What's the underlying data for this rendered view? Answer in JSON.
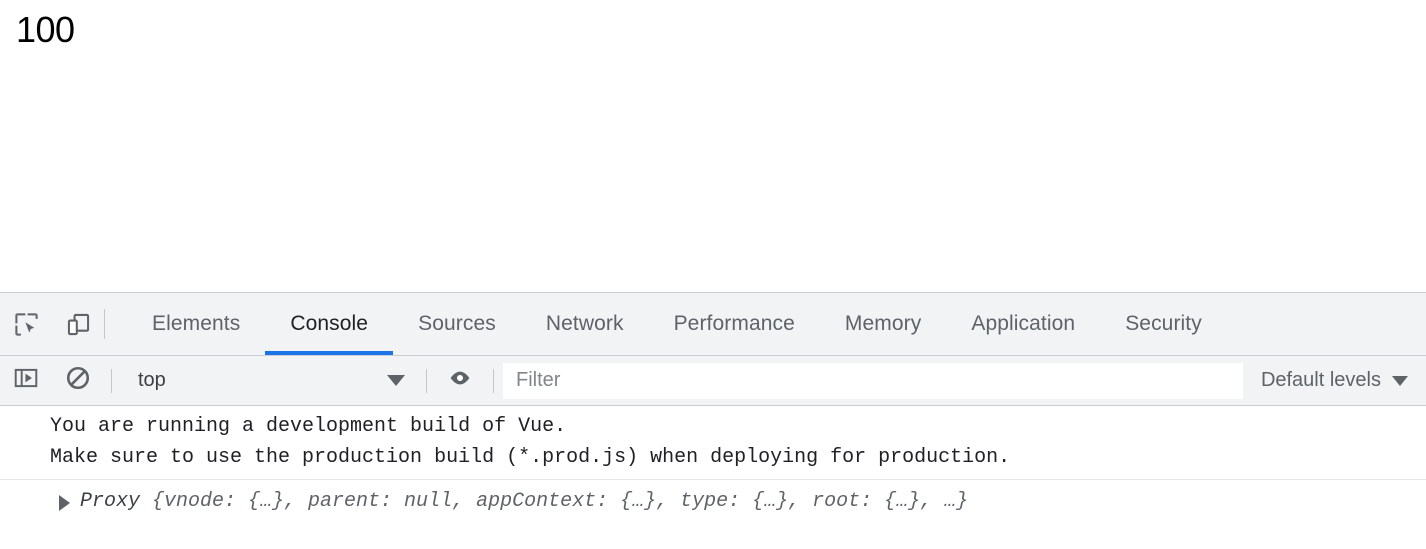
{
  "page": {
    "counter_value": "100"
  },
  "devtools": {
    "toolbar_icons": [
      {
        "name": "inspect-element-icon",
        "title": "Inspect element"
      },
      {
        "name": "device-toolbar-icon",
        "title": "Toggle device toolbar"
      }
    ],
    "tabs": [
      {
        "label": "Elements",
        "active": false
      },
      {
        "label": "Console",
        "active": true
      },
      {
        "label": "Sources",
        "active": false
      },
      {
        "label": "Network",
        "active": false
      },
      {
        "label": "Performance",
        "active": false
      },
      {
        "label": "Memory",
        "active": false
      },
      {
        "label": "Application",
        "active": false
      },
      {
        "label": "Security",
        "active": false
      }
    ],
    "active_tab": "Console",
    "accent_color": "#1a73e8",
    "toolbar_background": "#f1f3f4",
    "console_toolbar": {
      "sidebar_toggle_icon": "console-sidebar-icon",
      "clear_console_icon": "clear-console-icon",
      "eye_icon": "live-expression-eye-icon",
      "context_value": "top",
      "context_caret": "chevron-down-icon",
      "filter_placeholder": "Filter",
      "filter_value": "",
      "levels_label": "Default levels",
      "levels_caret": "chevron-down-icon"
    },
    "console_messages": [
      {
        "type": "warning-text",
        "lines": [
          "You are running a development build of Vue.",
          "Make sure to use the production build (*.prod.js) when deploying for production."
        ]
      },
      {
        "type": "object",
        "expanded": false,
        "disclosure_icon": "disclosure-triangle-icon",
        "class_name": "Proxy",
        "preview": " {vnode: {…}, parent: null, appContext: {…}, type: {…}, root: {…}, …}"
      }
    ]
  }
}
